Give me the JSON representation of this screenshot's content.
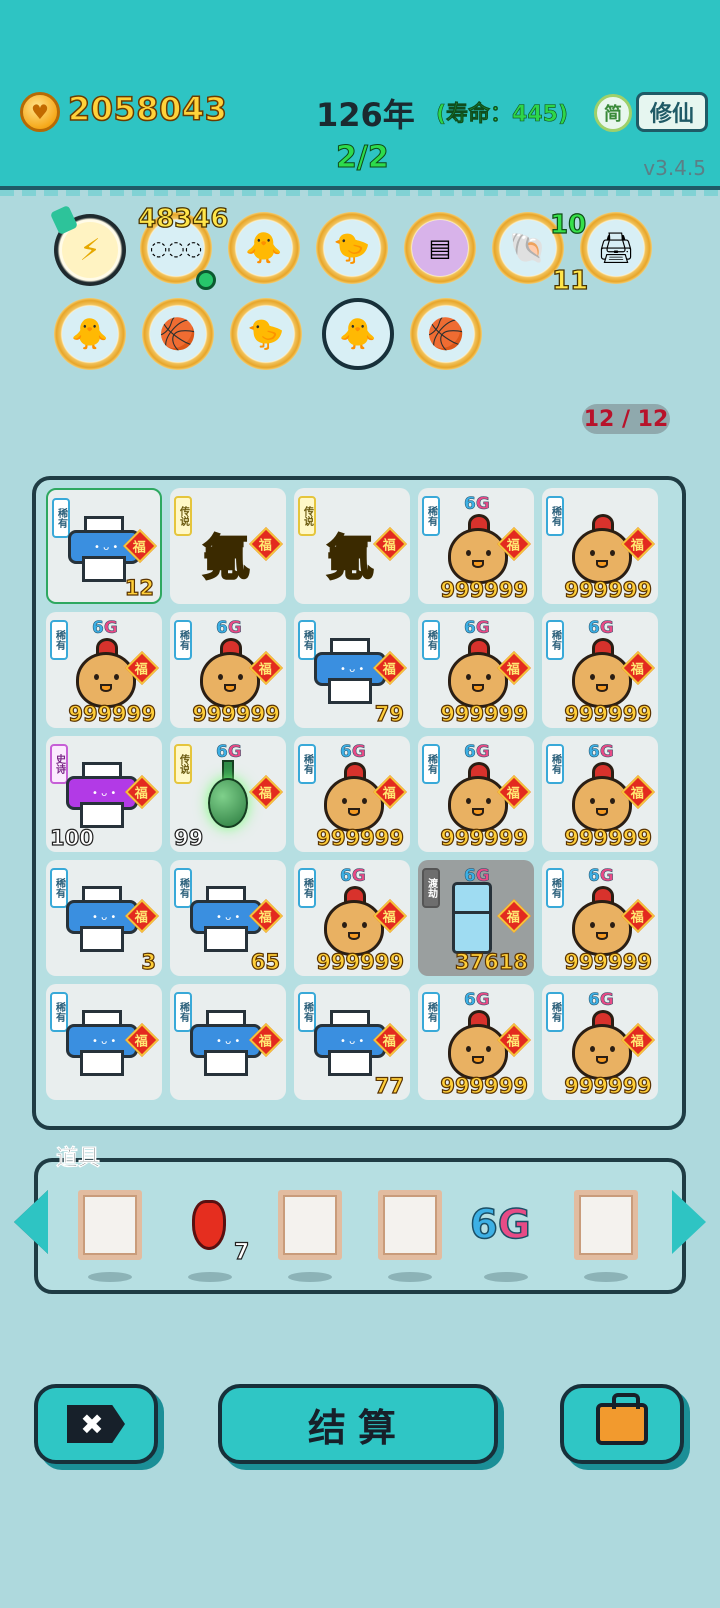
{
  "header": {
    "coins": "2058043",
    "year": "126年",
    "lifespan": "(寿命：445)",
    "simplified_label": "简",
    "cultivate_label": "修仙",
    "round": "2/2",
    "version": "v3.4.5"
  },
  "buffs": {
    "counts": {
      "first_count": "48346",
      "shell_top": "10",
      "shell_bottom": "11"
    },
    "icons": [
      "lightning-icon",
      "egg-tray-icon",
      "syringe-chick-icon",
      "chick-egg-icon",
      "skirt-icon",
      "shell-icon",
      "printer-warning-icon",
      "syringe-chick-icon",
      "basketball-icon",
      "chick-egg-icon",
      "syringe-chick-icon",
      "basketball-icon"
    ]
  },
  "board": {
    "counter": "12 / 12",
    "tags": {
      "rare": "稀有",
      "legend": "传说",
      "epic": "史诗",
      "dujie": "渡劫",
      "fu": "福",
      "tag6g_a": "6",
      "tag6g_b": "G",
      "ammonia": "氪"
    },
    "cells": [
      {
        "item": "printer",
        "rarity": "rare",
        "count": "12",
        "six_g": false,
        "selected": true
      },
      {
        "item": "ammonia",
        "rarity": "legend",
        "count": "",
        "six_g": false
      },
      {
        "item": "ammonia",
        "rarity": "legend",
        "count": "",
        "six_g": false
      },
      {
        "item": "chick",
        "rarity": "rare",
        "count": "999999",
        "six_g": true
      },
      {
        "item": "chick",
        "rarity": "rare",
        "count": "999999",
        "six_g": false
      },
      {
        "item": "chick",
        "rarity": "rare",
        "count": "999999",
        "six_g": true
      },
      {
        "item": "chick",
        "rarity": "rare",
        "count": "999999",
        "six_g": true
      },
      {
        "item": "printer",
        "rarity": "rare",
        "count": "79",
        "six_g": false
      },
      {
        "item": "chick",
        "rarity": "rare",
        "count": "999999",
        "six_g": true
      },
      {
        "item": "chick",
        "rarity": "rare",
        "count": "999999",
        "six_g": true
      },
      {
        "item": "printer-epic",
        "rarity": "epic",
        "count": "100",
        "six_g": false
      },
      {
        "item": "vase",
        "rarity": "legend",
        "count": "99",
        "six_g": true
      },
      {
        "item": "chick",
        "rarity": "rare",
        "count": "999999",
        "six_g": true
      },
      {
        "item": "chick",
        "rarity": "rare",
        "count": "999999",
        "six_g": true
      },
      {
        "item": "chick",
        "rarity": "rare",
        "count": "999999",
        "six_g": true
      },
      {
        "item": "printer",
        "rarity": "rare",
        "count": "3",
        "six_g": false
      },
      {
        "item": "printer",
        "rarity": "rare",
        "count": "65",
        "six_g": false
      },
      {
        "item": "chick",
        "rarity": "rare",
        "count": "999999",
        "six_g": true
      },
      {
        "item": "fridge",
        "rarity": "dujie",
        "count": "37618",
        "six_g": true
      },
      {
        "item": "chick",
        "rarity": "rare",
        "count": "999999",
        "six_g": true
      },
      {
        "item": "printer",
        "rarity": "rare",
        "count": "",
        "six_g": false
      },
      {
        "item": "printer",
        "rarity": "rare",
        "count": "",
        "six_g": false
      },
      {
        "item": "printer",
        "rarity": "rare",
        "count": "77",
        "six_g": false
      },
      {
        "item": "chick",
        "rarity": "rare",
        "count": "999999",
        "six_g": true
      },
      {
        "item": "chick",
        "rarity": "rare",
        "count": "999999",
        "six_g": true
      }
    ]
  },
  "tray": {
    "title": "道具",
    "pepper_count": "7",
    "six_g_a": "6",
    "six_g_b": "G",
    "slots": [
      "empty",
      "pepper",
      "empty",
      "empty",
      "6g",
      "empty"
    ]
  },
  "buttons": {
    "close_icon": "✖",
    "settle_label": "结算",
    "bag_icon": "briefcase-icon"
  },
  "colors": {
    "header_bg": "#2ec4c3",
    "page_bg": "#aed9dd",
    "coin_text": "#ffd23a",
    "lifespan_text": "#2dd64a"
  }
}
